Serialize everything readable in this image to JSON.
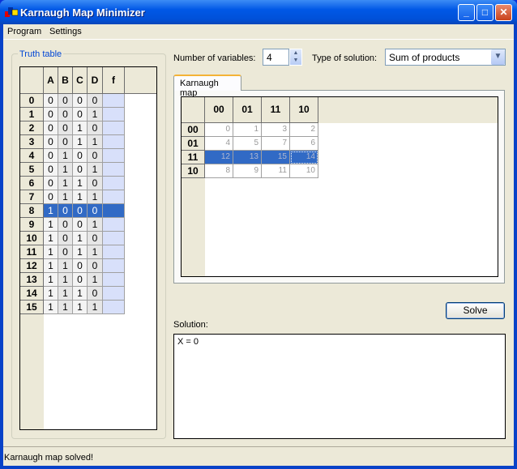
{
  "window": {
    "title": "Karnaugh Map Minimizer",
    "controls": [
      "minimize",
      "maximize",
      "close"
    ]
  },
  "menu": [
    "Program",
    "Settings"
  ],
  "truth_table": {
    "group_label": "Truth table",
    "headers": [
      "A",
      "B",
      "C",
      "D",
      "f"
    ],
    "selected_row": 8,
    "rows": [
      {
        "n": "0",
        "v": [
          "0",
          "0",
          "0",
          "0"
        ],
        "f": ""
      },
      {
        "n": "1",
        "v": [
          "0",
          "0",
          "0",
          "1"
        ],
        "f": ""
      },
      {
        "n": "2",
        "v": [
          "0",
          "0",
          "1",
          "0"
        ],
        "f": ""
      },
      {
        "n": "3",
        "v": [
          "0",
          "0",
          "1",
          "1"
        ],
        "f": ""
      },
      {
        "n": "4",
        "v": [
          "0",
          "1",
          "0",
          "0"
        ],
        "f": ""
      },
      {
        "n": "5",
        "v": [
          "0",
          "1",
          "0",
          "1"
        ],
        "f": ""
      },
      {
        "n": "6",
        "v": [
          "0",
          "1",
          "1",
          "0"
        ],
        "f": ""
      },
      {
        "n": "7",
        "v": [
          "0",
          "1",
          "1",
          "1"
        ],
        "f": ""
      },
      {
        "n": "8",
        "v": [
          "1",
          "0",
          "0",
          "0"
        ],
        "f": ""
      },
      {
        "n": "9",
        "v": [
          "1",
          "0",
          "0",
          "1"
        ],
        "f": ""
      },
      {
        "n": "10",
        "v": [
          "1",
          "0",
          "1",
          "0"
        ],
        "f": ""
      },
      {
        "n": "11",
        "v": [
          "1",
          "0",
          "1",
          "1"
        ],
        "f": ""
      },
      {
        "n": "12",
        "v": [
          "1",
          "1",
          "0",
          "0"
        ],
        "f": ""
      },
      {
        "n": "13",
        "v": [
          "1",
          "1",
          "0",
          "1"
        ],
        "f": ""
      },
      {
        "n": "14",
        "v": [
          "1",
          "1",
          "1",
          "0"
        ],
        "f": ""
      },
      {
        "n": "15",
        "v": [
          "1",
          "1",
          "1",
          "1"
        ],
        "f": ""
      }
    ]
  },
  "controls": {
    "num_vars_label": "Number of variables:",
    "num_vars": "4",
    "solution_type_label": "Type of solution:",
    "solution_type": "Sum of products"
  },
  "tab": {
    "label": "Karnaugh map"
  },
  "kmap": {
    "col_headers": [
      "00",
      "01",
      "11",
      "10"
    ],
    "selected_row": 2,
    "rows": [
      {
        "h": "00",
        "cells": [
          "0",
          "1",
          "3",
          "2"
        ]
      },
      {
        "h": "01",
        "cells": [
          "4",
          "5",
          "7",
          "6"
        ]
      },
      {
        "h": "11",
        "cells": [
          "12",
          "13",
          "15",
          "14"
        ]
      },
      {
        "h": "10",
        "cells": [
          "8",
          "9",
          "11",
          "10"
        ]
      }
    ]
  },
  "solve_label": "Solve",
  "solution": {
    "label": "Solution:",
    "text": "X = 0"
  },
  "status": "Karnaugh map solved!",
  "colors": {
    "title_bar": "#0054e3",
    "selection": "#316ac5",
    "f_column": "#d8e0fa",
    "face": "#ece9d8"
  }
}
